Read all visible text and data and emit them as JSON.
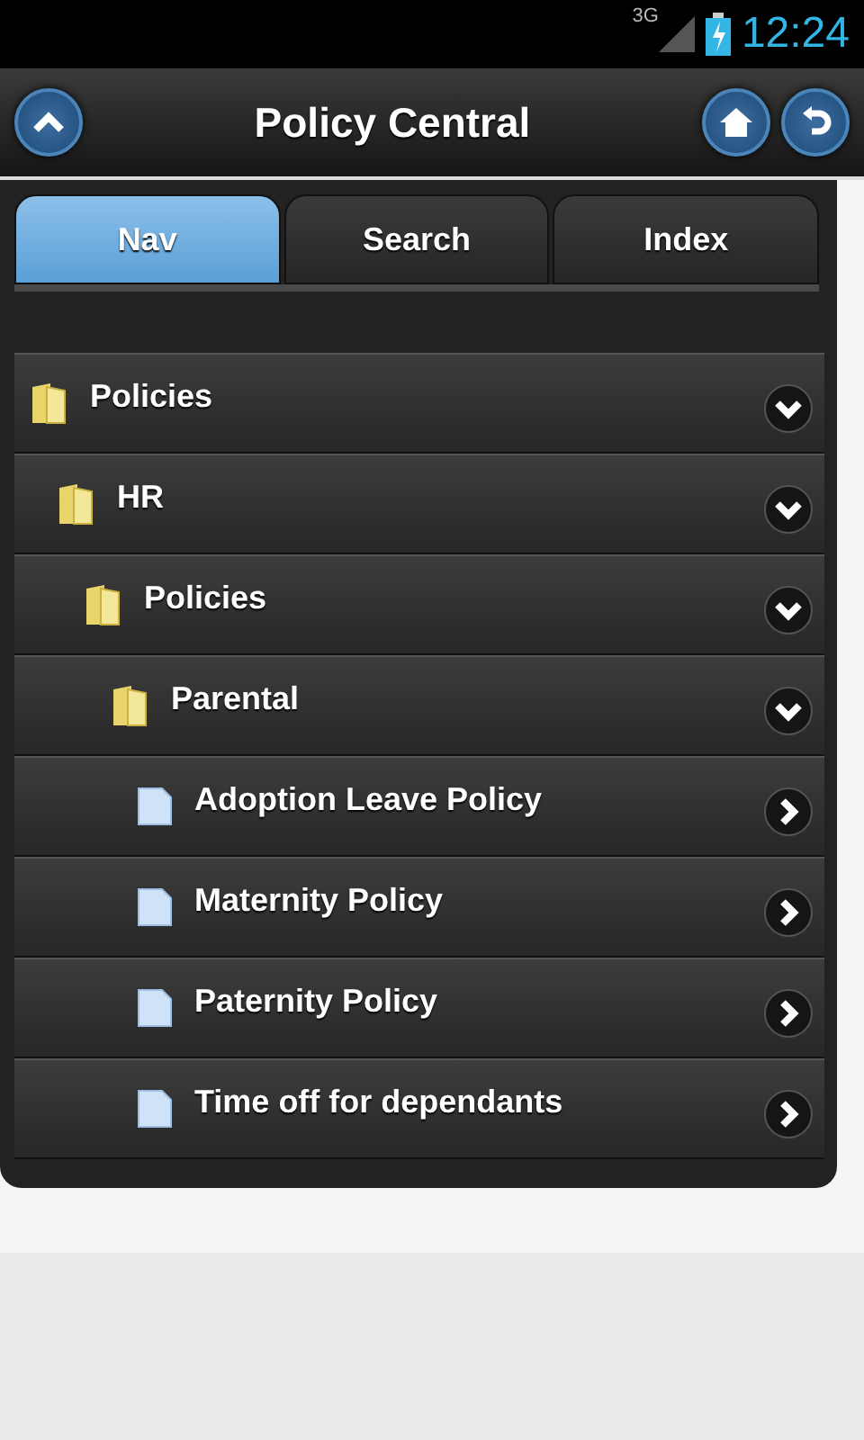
{
  "status_bar": {
    "network": "3G",
    "time": "12:24"
  },
  "header": {
    "title": "Policy Central"
  },
  "tabs": [
    {
      "label": "Nav",
      "selected": true
    },
    {
      "label": "Search",
      "selected": false
    },
    {
      "label": "Index",
      "selected": false
    }
  ],
  "tree": [
    {
      "kind": "folder",
      "label": "Policies",
      "expanded": true,
      "children": [
        {
          "kind": "folder",
          "label": "HR",
          "expanded": true,
          "children": [
            {
              "kind": "folder",
              "label": "Policies",
              "expanded": true,
              "children": [
                {
                  "kind": "folder",
                  "label": "Parental",
                  "expanded": true,
                  "children": [
                    {
                      "kind": "document",
                      "label": "Adoption Leave Policy"
                    },
                    {
                      "kind": "document",
                      "label": "Maternity Policy"
                    },
                    {
                      "kind": "document",
                      "label": "Paternity Policy"
                    },
                    {
                      "kind": "document",
                      "label": "Time off for dependants"
                    }
                  ]
                }
              ]
            }
          ]
        }
      ]
    }
  ]
}
